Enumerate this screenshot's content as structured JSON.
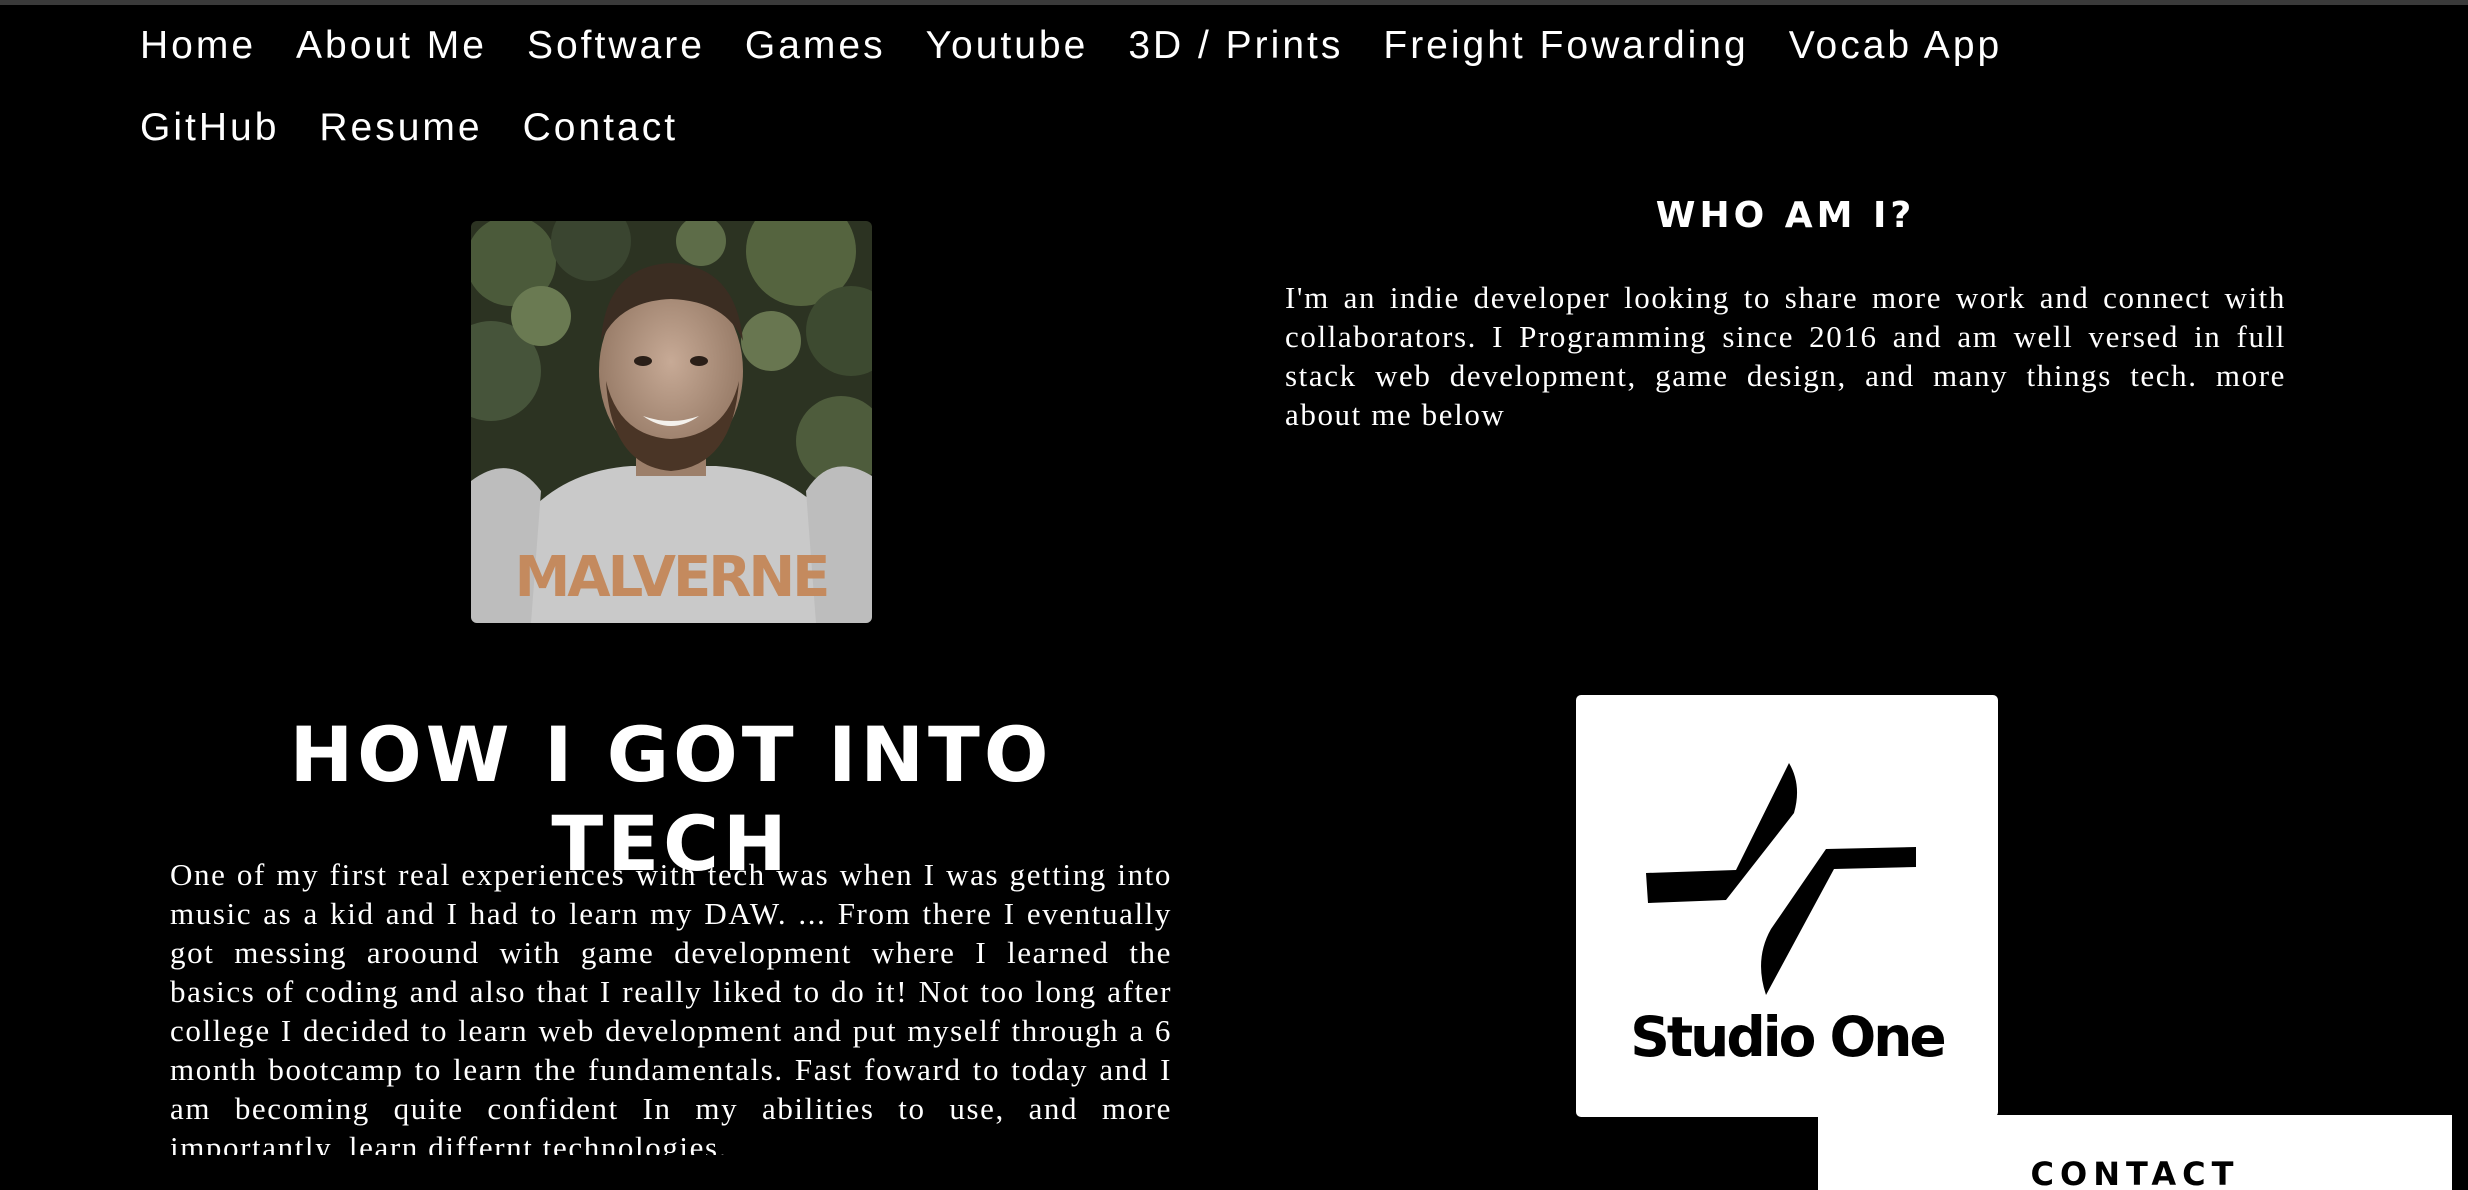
{
  "nav": {
    "row1": [
      "Home",
      "About Me",
      "Software",
      "Games",
      "Youtube",
      "3D / Prints",
      "Freight Fowarding",
      "Vocab App"
    ],
    "row2": [
      "GitHub",
      "Resume",
      "Contact"
    ]
  },
  "who": {
    "title": "WHO AM I?",
    "text": "I'm an indie developer looking to share more work and connect with collaborators. I Programming since 2016 and am well versed in full stack web development, game design, and many things tech. more about me below"
  },
  "tech": {
    "title": "HOW I GOT INTO TECH",
    "text": "One of my first real experiences with tech was when I was getting into music as a kid and I had to learn my DAW. ... From there I eventually got messing aroound with game development where I learned the basics of coding and also that I really liked to do it! Not too long after college I decided to learn web development and put myself through a 6 month bootcamp to learn the fundamentals. Fast foward to today and I am becoming quite confident In my abilities to use, and more importantly, learn differnt technologies."
  },
  "portrait": {
    "sweatshirt_text": "MALVERNE"
  },
  "logo": {
    "name": "Studio One"
  },
  "contact_tab": {
    "label": "CONTACT"
  },
  "colors": {
    "background": "#000000",
    "text": "#ffffff",
    "tab_background": "#ffffff"
  }
}
